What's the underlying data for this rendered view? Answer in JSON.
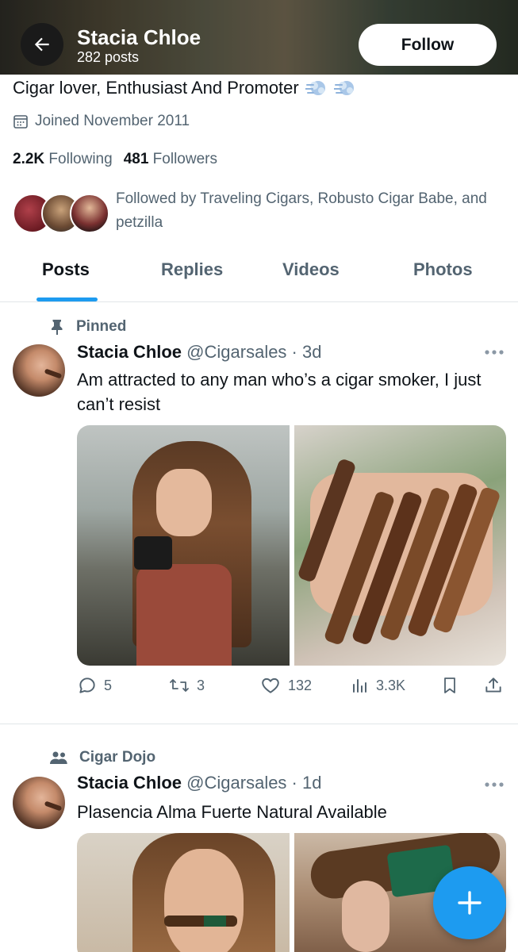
{
  "header": {
    "name": "Stacia Chloe",
    "posts_count": "282 posts",
    "follow_label": "Follow"
  },
  "profile": {
    "bio": "Cigar lover, Enthusiast And Promoter",
    "joined": "Joined November 2011",
    "following_count": "2.2K",
    "following_label": "Following",
    "followers_count": "481",
    "followers_label": "Followers",
    "followed_by": "Followed by Traveling Cigars, Robusto Cigar Babe, and petzilla"
  },
  "tabs": [
    {
      "label": "Posts",
      "active": true
    },
    {
      "label": "Replies",
      "active": false
    },
    {
      "label": "Videos",
      "active": false
    },
    {
      "label": "Photos",
      "active": false
    }
  ],
  "posts": [
    {
      "context": "Pinned",
      "context_icon": "pin-icon",
      "author": "Stacia Chloe",
      "meta": "@Cigarsales · 3d",
      "text": "Am attracted to any man who’s a cigar smoker, I just can’t resist",
      "replies": "5",
      "reposts": "3",
      "likes": "132",
      "views": "3.3K"
    },
    {
      "context": "Cigar Dojo",
      "context_icon": "community-icon",
      "author": "Stacia Chloe",
      "meta": "@Cigarsales · 1d",
      "text": "Plasencia Alma Fuerte Natural Available"
    }
  ],
  "colors": {
    "accent": "#1d9bf0",
    "text_primary": "#0f1419",
    "text_secondary": "#536471"
  }
}
